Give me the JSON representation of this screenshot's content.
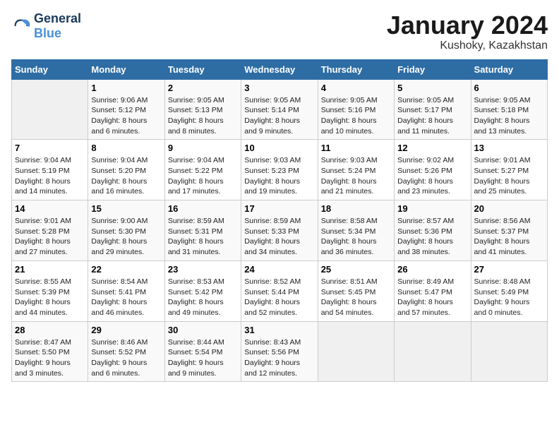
{
  "logo": {
    "line1": "General",
    "line2": "Blue"
  },
  "title": "January 2024",
  "subtitle": "Kushoky, Kazakhstan",
  "headers": [
    "Sunday",
    "Monday",
    "Tuesday",
    "Wednesday",
    "Thursday",
    "Friday",
    "Saturday"
  ],
  "weeks": [
    [
      {
        "day": "",
        "sunrise": "",
        "sunset": "",
        "daylight": ""
      },
      {
        "day": "1",
        "sunrise": "Sunrise: 9:06 AM",
        "sunset": "Sunset: 5:12 PM",
        "daylight": "Daylight: 8 hours and 6 minutes."
      },
      {
        "day": "2",
        "sunrise": "Sunrise: 9:05 AM",
        "sunset": "Sunset: 5:13 PM",
        "daylight": "Daylight: 8 hours and 8 minutes."
      },
      {
        "day": "3",
        "sunrise": "Sunrise: 9:05 AM",
        "sunset": "Sunset: 5:14 PM",
        "daylight": "Daylight: 8 hours and 9 minutes."
      },
      {
        "day": "4",
        "sunrise": "Sunrise: 9:05 AM",
        "sunset": "Sunset: 5:16 PM",
        "daylight": "Daylight: 8 hours and 10 minutes."
      },
      {
        "day": "5",
        "sunrise": "Sunrise: 9:05 AM",
        "sunset": "Sunset: 5:17 PM",
        "daylight": "Daylight: 8 hours and 11 minutes."
      },
      {
        "day": "6",
        "sunrise": "Sunrise: 9:05 AM",
        "sunset": "Sunset: 5:18 PM",
        "daylight": "Daylight: 8 hours and 13 minutes."
      }
    ],
    [
      {
        "day": "7",
        "sunrise": "Sunrise: 9:04 AM",
        "sunset": "Sunset: 5:19 PM",
        "daylight": "Daylight: 8 hours and 14 minutes."
      },
      {
        "day": "8",
        "sunrise": "Sunrise: 9:04 AM",
        "sunset": "Sunset: 5:20 PM",
        "daylight": "Daylight: 8 hours and 16 minutes."
      },
      {
        "day": "9",
        "sunrise": "Sunrise: 9:04 AM",
        "sunset": "Sunset: 5:22 PM",
        "daylight": "Daylight: 8 hours and 17 minutes."
      },
      {
        "day": "10",
        "sunrise": "Sunrise: 9:03 AM",
        "sunset": "Sunset: 5:23 PM",
        "daylight": "Daylight: 8 hours and 19 minutes."
      },
      {
        "day": "11",
        "sunrise": "Sunrise: 9:03 AM",
        "sunset": "Sunset: 5:24 PM",
        "daylight": "Daylight: 8 hours and 21 minutes."
      },
      {
        "day": "12",
        "sunrise": "Sunrise: 9:02 AM",
        "sunset": "Sunset: 5:26 PM",
        "daylight": "Daylight: 8 hours and 23 minutes."
      },
      {
        "day": "13",
        "sunrise": "Sunrise: 9:01 AM",
        "sunset": "Sunset: 5:27 PM",
        "daylight": "Daylight: 8 hours and 25 minutes."
      }
    ],
    [
      {
        "day": "14",
        "sunrise": "Sunrise: 9:01 AM",
        "sunset": "Sunset: 5:28 PM",
        "daylight": "Daylight: 8 hours and 27 minutes."
      },
      {
        "day": "15",
        "sunrise": "Sunrise: 9:00 AM",
        "sunset": "Sunset: 5:30 PM",
        "daylight": "Daylight: 8 hours and 29 minutes."
      },
      {
        "day": "16",
        "sunrise": "Sunrise: 8:59 AM",
        "sunset": "Sunset: 5:31 PM",
        "daylight": "Daylight: 8 hours and 31 minutes."
      },
      {
        "day": "17",
        "sunrise": "Sunrise: 8:59 AM",
        "sunset": "Sunset: 5:33 PM",
        "daylight": "Daylight: 8 hours and 34 minutes."
      },
      {
        "day": "18",
        "sunrise": "Sunrise: 8:58 AM",
        "sunset": "Sunset: 5:34 PM",
        "daylight": "Daylight: 8 hours and 36 minutes."
      },
      {
        "day": "19",
        "sunrise": "Sunrise: 8:57 AM",
        "sunset": "Sunset: 5:36 PM",
        "daylight": "Daylight: 8 hours and 38 minutes."
      },
      {
        "day": "20",
        "sunrise": "Sunrise: 8:56 AM",
        "sunset": "Sunset: 5:37 PM",
        "daylight": "Daylight: 8 hours and 41 minutes."
      }
    ],
    [
      {
        "day": "21",
        "sunrise": "Sunrise: 8:55 AM",
        "sunset": "Sunset: 5:39 PM",
        "daylight": "Daylight: 8 hours and 44 minutes."
      },
      {
        "day": "22",
        "sunrise": "Sunrise: 8:54 AM",
        "sunset": "Sunset: 5:41 PM",
        "daylight": "Daylight: 8 hours and 46 minutes."
      },
      {
        "day": "23",
        "sunrise": "Sunrise: 8:53 AM",
        "sunset": "Sunset: 5:42 PM",
        "daylight": "Daylight: 8 hours and 49 minutes."
      },
      {
        "day": "24",
        "sunrise": "Sunrise: 8:52 AM",
        "sunset": "Sunset: 5:44 PM",
        "daylight": "Daylight: 8 hours and 52 minutes."
      },
      {
        "day": "25",
        "sunrise": "Sunrise: 8:51 AM",
        "sunset": "Sunset: 5:45 PM",
        "daylight": "Daylight: 8 hours and 54 minutes."
      },
      {
        "day": "26",
        "sunrise": "Sunrise: 8:49 AM",
        "sunset": "Sunset: 5:47 PM",
        "daylight": "Daylight: 8 hours and 57 minutes."
      },
      {
        "day": "27",
        "sunrise": "Sunrise: 8:48 AM",
        "sunset": "Sunset: 5:49 PM",
        "daylight": "Daylight: 9 hours and 0 minutes."
      }
    ],
    [
      {
        "day": "28",
        "sunrise": "Sunrise: 8:47 AM",
        "sunset": "Sunset: 5:50 PM",
        "daylight": "Daylight: 9 hours and 3 minutes."
      },
      {
        "day": "29",
        "sunrise": "Sunrise: 8:46 AM",
        "sunset": "Sunset: 5:52 PM",
        "daylight": "Daylight: 9 hours and 6 minutes."
      },
      {
        "day": "30",
        "sunrise": "Sunrise: 8:44 AM",
        "sunset": "Sunset: 5:54 PM",
        "daylight": "Daylight: 9 hours and 9 minutes."
      },
      {
        "day": "31",
        "sunrise": "Sunrise: 8:43 AM",
        "sunset": "Sunset: 5:56 PM",
        "daylight": "Daylight: 9 hours and 12 minutes."
      },
      {
        "day": "",
        "sunrise": "",
        "sunset": "",
        "daylight": ""
      },
      {
        "day": "",
        "sunrise": "",
        "sunset": "",
        "daylight": ""
      },
      {
        "day": "",
        "sunrise": "",
        "sunset": "",
        "daylight": ""
      }
    ]
  ]
}
